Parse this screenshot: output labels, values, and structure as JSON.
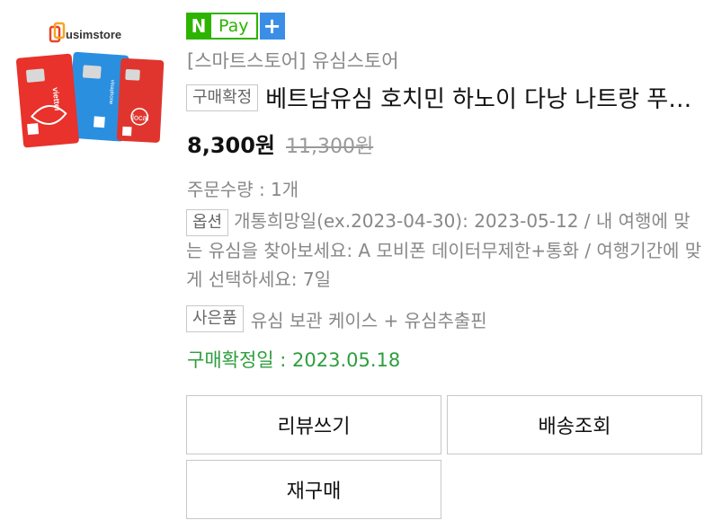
{
  "thumbnail": {
    "logo_text": "usimstore",
    "card_texts": [
      "viettel",
      "vinaphone",
      "local"
    ]
  },
  "badge": {
    "n_label": "N",
    "pay_label": "Pay",
    "plus_label": "+"
  },
  "store": {
    "name": "[스마트스토어] 유심스토어"
  },
  "product": {
    "status_tag": "구매확정",
    "title": "베트남유심 호치민 하노이 다낭 나트랑 푸꾸옥",
    "price": "8,300원",
    "original_price": "11,300원"
  },
  "order": {
    "quantity": "주문수량 : 1개",
    "option_tag": "옵션",
    "option_text": "개통희망일(ex.2023-04-30): 2023-05-12 / 내 여행에 맞는 유심을 찾아보세요: A 모비폰 데이터무제한+통화 / 여행기간에 맞게 선택하세요: 7일",
    "gift_tag": "사은품",
    "gift_text": "유심 보관 케이스 + 유심추출핀",
    "confirm_date": "구매확정일 : 2023.05.18"
  },
  "buttons": {
    "review": "리뷰쓰기",
    "track": "배송조회",
    "rebuy": "재구매"
  },
  "colors": {
    "naver_green": "#2db400",
    "plus_blue": "#3a8ee6",
    "confirm_green": "#2d9e3e"
  }
}
